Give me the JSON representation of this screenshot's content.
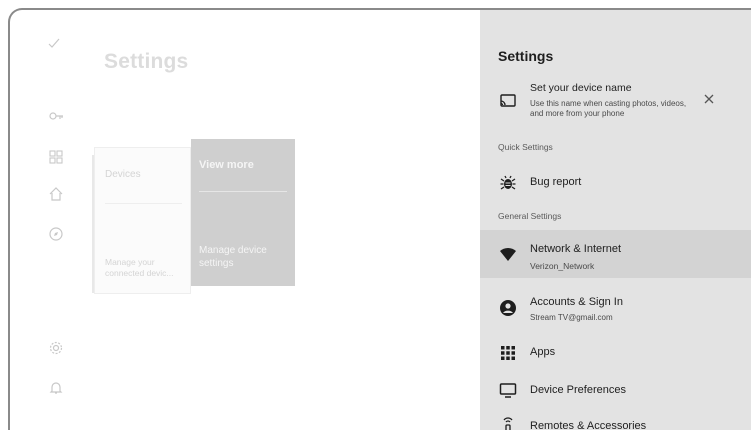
{
  "background": {
    "title": "Settings",
    "devices_card": {
      "title": "Devices",
      "description": "Manage your connected devic..."
    },
    "view_more_card": {
      "title": "View more",
      "description": "Manage device settings"
    }
  },
  "rail": {
    "icons": [
      "account-check-icon",
      "key-icon",
      "apps-grid-icon",
      "home-icon",
      "discover-icon",
      "gear-icon",
      "bell-icon"
    ]
  },
  "panel": {
    "title": "Settings",
    "device_name": {
      "title": "Set your device name",
      "description_line1": "Use this name when casting photos, videos,",
      "description_line2": "and more from your phone"
    },
    "quick_settings_header": "Quick Settings",
    "bug_report": "Bug report",
    "general_settings_header": "General Settings",
    "network": {
      "title": "Network & Internet",
      "subtitle": "Verizon_Network"
    },
    "accounts": {
      "title": "Accounts & Sign In",
      "subtitle": "Stream TV@gmail.com"
    },
    "apps": "Apps",
    "device_preferences": "Device Preferences",
    "remotes": "Remotes & Accessories"
  },
  "colors": {
    "panel_bg": "#e3e3e3",
    "highlight_bg": "#d3d3d3",
    "card_focus": "#cfcfcf",
    "text_primary": "#1e1e1e"
  }
}
